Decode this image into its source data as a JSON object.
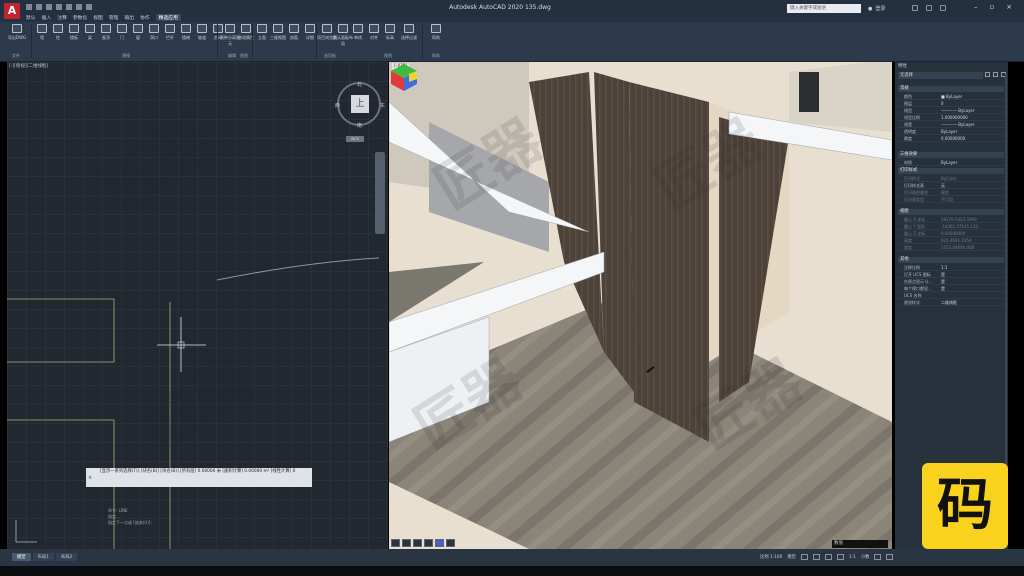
{
  "app": {
    "title": "Autodesk AutoCAD 2020    135.dwg",
    "logo_letter": "A",
    "search_placeholder": "键入关键字或短语",
    "login_label": "登录"
  },
  "menu_tabs": [
    "默认",
    "插入",
    "注释",
    "参数化",
    "视图",
    "管理",
    "输出",
    "协作",
    "精选应用"
  ],
  "menu_tabs_active": "精选应用",
  "ribbon": {
    "buttons": [
      "导出DWG",
      "墙",
      "柱",
      "楼板",
      "梁",
      "屋顶",
      "门",
      "窗",
      "洞口",
      "栏杆",
      "楼梯",
      "坡道",
      "房间",
      "两种分离图元",
      "修改属性",
      "立面",
      "三维视图",
      "剖面",
      "详图",
      "项目浏览器",
      "默认面板布局",
      "单线",
      "对齐",
      "标高",
      "选择过滤",
      "帮助"
    ],
    "panels": [
      "文件",
      "建模",
      "编辑",
      "视图",
      "选项板",
      "视图",
      "帮助"
    ]
  },
  "left_viewport": {
    "label": "[-][俯视][二维线框]",
    "viewcube": {
      "top": "上",
      "north": "北",
      "south": "南",
      "west": "西",
      "east": "东",
      "wcs": "WCS"
    },
    "command_history": [
      "命令: LINE",
      "指定...",
      "指定下一点或 [放弃(U)]:"
    ],
    "command_line": "[显示一系列选择(T)] [块名(B)] [块名(B)]    [所有层] 0.00000 米    [面积计算] 0.00000 m²    [线性计算] 0"
  },
  "right_viewport": {
    "label": "[-][透]",
    "status_label": "数值"
  },
  "watermark": "匠器",
  "properties": {
    "header": "特性",
    "selection": "无选择",
    "sections": [
      {
        "title": "常规",
        "rows": [
          {
            "k": "颜色",
            "v": "■ ByLayer"
          },
          {
            "k": "图层",
            "v": "0"
          },
          {
            "k": "线型",
            "v": "———— ByLayer"
          },
          {
            "k": "线型比例",
            "v": "1.000000000"
          },
          {
            "k": "线宽",
            "v": "———— ByLayer"
          },
          {
            "k": "透明度",
            "v": "ByLayer"
          },
          {
            "k": "厚度",
            "v": "0.00000000"
          }
        ]
      },
      {
        "title": "三维效果",
        "rows": [
          {
            "k": "材质",
            "v": "ByLayer"
          }
        ]
      },
      {
        "title": "打印样式",
        "rows": [
          {
            "k": "打印样式",
            "v": "ByColor"
          },
          {
            "k": "打印样式表",
            "v": "无"
          },
          {
            "k": "打印表附着到",
            "v": "模型"
          },
          {
            "k": "打印表类型",
            "v": "不可用"
          }
        ]
      },
      {
        "title": "视图",
        "rows": [
          {
            "k": "圆心 X 坐标",
            "v": "29179.5463.5990"
          },
          {
            "k": "圆心 Y 坐标",
            "v": "-14361.47141.132"
          },
          {
            "k": "圆心 Z 坐标",
            "v": "0.00000000"
          },
          {
            "k": "高度",
            "v": "635.4691.1654"
          },
          {
            "k": "宽度",
            "v": "1523.04694.008"
          }
        ]
      },
      {
        "title": "其他",
        "rows": [
          {
            "k": "注释比例",
            "v": "1:1"
          },
          {
            "k": "打开 UCS 图标",
            "v": "是"
          },
          {
            "k": "在原点显示 U...",
            "v": "是"
          },
          {
            "k": "每个视口都显...",
            "v": "是"
          },
          {
            "k": "UCS 名称",
            "v": ""
          },
          {
            "k": "视觉样式",
            "v": "二维线框"
          }
        ]
      }
    ]
  },
  "badge": {
    "glyph": "码",
    "color": "#f9d21d"
  },
  "status_bar": {
    "tabs": [
      "模型",
      "布局1",
      "布局2"
    ],
    "active_tab": "模型",
    "scale": "比例 1:100",
    "model_label": "模型",
    "annotation": "1:1",
    "coords_label": "小数",
    "anno_label": "默认注释比例"
  }
}
